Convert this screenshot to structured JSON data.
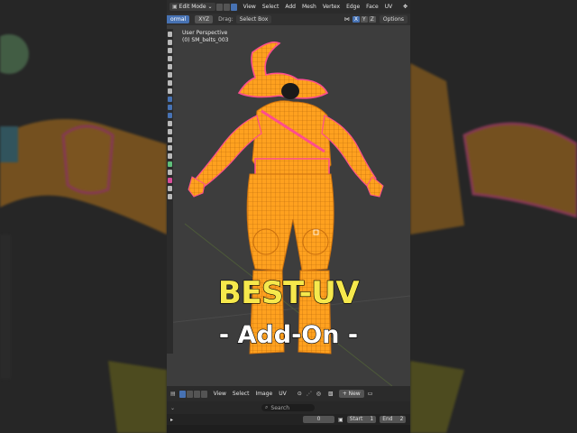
{
  "header": {
    "mode_label": "Edit Mode",
    "menus": [
      "View",
      "Select",
      "Add",
      "Mesh",
      "Vertex",
      "Edge",
      "Face",
      "UV"
    ]
  },
  "tool_header": {
    "orientation_label": "ormal",
    "pivot_label": "XYZ",
    "drag_label": "Drag:",
    "select_box_label": "Select Box",
    "axes": [
      "X",
      "Y",
      "Z"
    ],
    "options_label": "Options"
  },
  "viewport": {
    "perspective_label": "User Perspective",
    "object_label": "(0) SM_belts_003"
  },
  "overlay": {
    "title": "BEST-UV",
    "subtitle": "- Add-On -"
  },
  "uv_header": {
    "menus": [
      "View",
      "Select",
      "Image",
      "UV"
    ],
    "new_label": "New"
  },
  "search": {
    "placeholder": "Search"
  },
  "timeline": {
    "current_frame": "0",
    "start_label": "Start",
    "start_value": "1",
    "end_label": "End",
    "end_value": "2"
  },
  "colors": {
    "mesh_orange": "#ffa11f",
    "seam_pink": "#ff4d8d",
    "title_yellow": "#f6e84c",
    "ui_blue": "#4772b3"
  }
}
